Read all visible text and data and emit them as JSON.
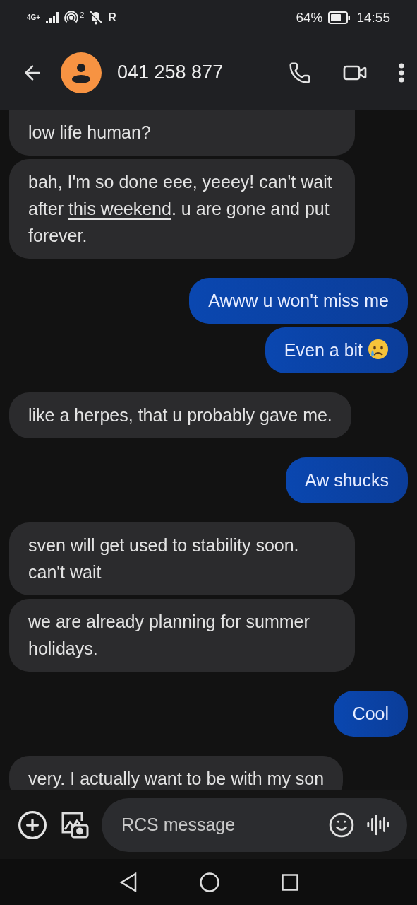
{
  "status_bar": {
    "network": "4G+",
    "hotspot_count": "2",
    "roaming": "R",
    "battery": "64%",
    "time": "14:55"
  },
  "header": {
    "contact": "041 258 877"
  },
  "messages": [
    {
      "kind": "incoming",
      "parts": [
        {
          "kind": "text",
          "text": "low life human?"
        }
      ]
    },
    {
      "kind": "incoming",
      "parts": [
        {
          "kind": "text",
          "text": "bah, I'm so done eee, yeeey! can't wait after "
        },
        {
          "kind": "link",
          "text": "this weekend"
        },
        {
          "kind": "text",
          "text": ". u are gone and put forever."
        }
      ]
    },
    {
      "kind": "outgoing",
      "parts": [
        {
          "kind": "text",
          "text": "Awww u won't miss me"
        }
      ]
    },
    {
      "kind": "outgoing",
      "parts": [
        {
          "kind": "text",
          "text": "Even a bit "
        },
        {
          "kind": "crying-emoji"
        }
      ]
    },
    {
      "kind": "incoming",
      "parts": [
        {
          "kind": "text",
          "text": "like a herpes, that u probably gave me."
        }
      ]
    },
    {
      "kind": "outgoing",
      "parts": [
        {
          "kind": "text",
          "text": "Aw shucks"
        }
      ]
    },
    {
      "kind": "incoming",
      "parts": [
        {
          "kind": "text",
          "text": "sven will get used to stability soon. can't wait"
        }
      ]
    },
    {
      "kind": "incoming",
      "parts": [
        {
          "kind": "text",
          "text": "we are already planning for summer holidays."
        }
      ]
    },
    {
      "kind": "outgoing",
      "parts": [
        {
          "kind": "text",
          "text": "Cool"
        }
      ]
    },
    {
      "kind": "incoming",
      "parts": [
        {
          "kind": "text",
          "text": "very. I actually want to be with my son"
        }
      ]
    }
  ],
  "composer": {
    "placeholder": "RCS message"
  }
}
